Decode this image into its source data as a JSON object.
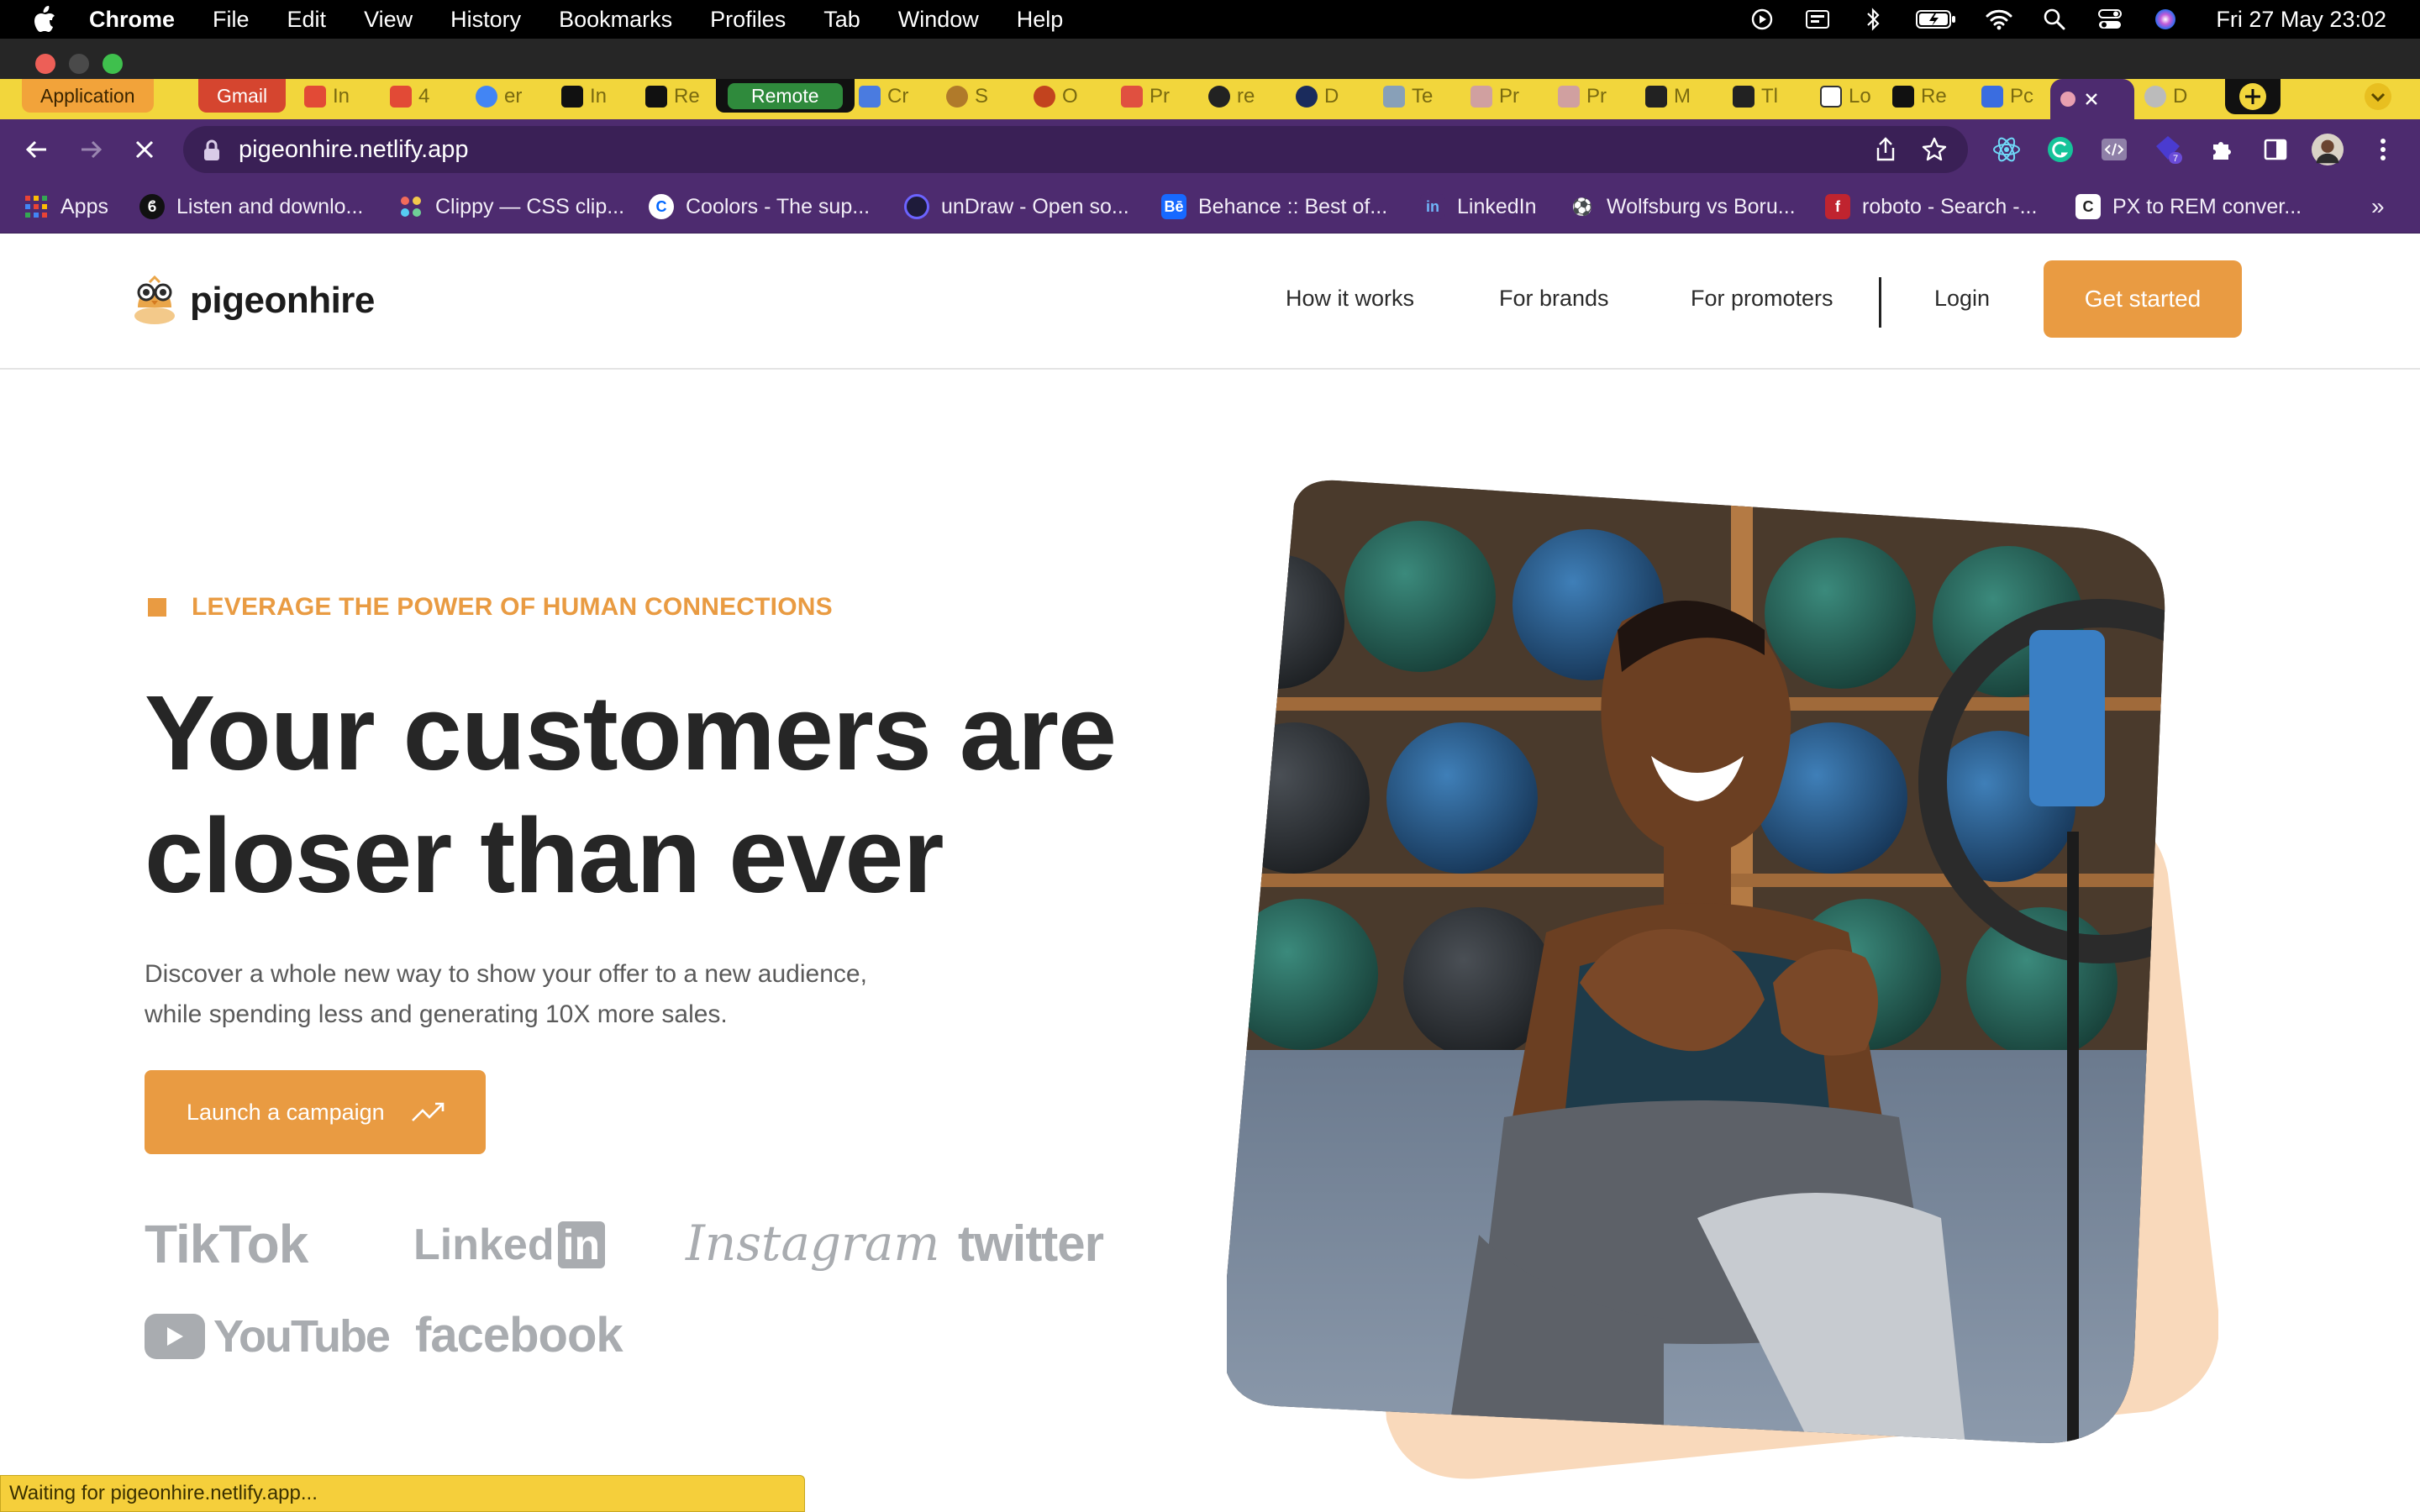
{
  "menubar": {
    "app": "Chrome",
    "items": [
      "File",
      "Edit",
      "View",
      "History",
      "Bookmarks",
      "Profiles",
      "Tab",
      "Window",
      "Help"
    ],
    "clock": "Fri 27 May  23:02"
  },
  "tabs": {
    "groups": [
      {
        "label": "Application",
        "color": "#f2a33a"
      },
      {
        "label": "Gmail",
        "color": "#d5452f"
      },
      {
        "label": "Remote",
        "color": "#2f8a3c"
      }
    ],
    "items": [
      "In",
      "4",
      "er",
      "In",
      "Re",
      "Cr",
      "S",
      "O",
      "Pr",
      "re",
      "D",
      "Te",
      "Pr",
      "Pr",
      "M",
      "Tl",
      "Lo",
      "Re",
      "Pc",
      "D"
    ]
  },
  "toolbar": {
    "url": "pigeonhire.netlify.app"
  },
  "bookmarks": [
    {
      "icon": "apps-grid-icon",
      "label": "Apps"
    },
    {
      "icon": "listen-icon",
      "label": "Listen and downlo..."
    },
    {
      "icon": "clippy-icon",
      "label": "Clippy — CSS clip..."
    },
    {
      "icon": "coolors-icon",
      "label": "Coolors - The sup..."
    },
    {
      "icon": "undraw-icon",
      "label": "unDraw - Open so..."
    },
    {
      "icon": "behance-icon",
      "label": "Behance :: Best of..."
    },
    {
      "icon": "linkedin-icon",
      "label": "LinkedIn"
    },
    {
      "icon": "football-icon",
      "label": "Wolfsburg vs Boru..."
    },
    {
      "icon": "roboto-icon",
      "label": "roboto - Search -..."
    },
    {
      "icon": "px-rem-icon",
      "label": "PX to REM conver..."
    }
  ],
  "site": {
    "brand": "pigeonhire",
    "nav": {
      "how": "How it works",
      "brands": "For brands",
      "promoters": "For promoters",
      "login": "Login",
      "cta": "Get started"
    },
    "hero": {
      "eyebrow": "LEVERAGE THE POWER OF HUMAN CONNECTIONS",
      "headline_line1": "Your customers are",
      "headline_line2": "closer than ever",
      "sub_line1": "Discover a whole new way to show your offer to a new audience,",
      "sub_line2": "while spending less and generating 10X more sales.",
      "cta": "Launch a campaign"
    },
    "platforms": {
      "tiktok": "TikTok",
      "linkedin_a": "Linked",
      "linkedin_b": "in",
      "instagram": "Instagram",
      "twitter": "twitter",
      "youtube": "YouTube",
      "facebook": "facebook"
    }
  },
  "status": "Waiting for pigeonhire.netlify.app...",
  "colors": {
    "accent": "#e99b42",
    "toolbar": "#4d2b6f",
    "tabstrip": "#f2d63c"
  }
}
